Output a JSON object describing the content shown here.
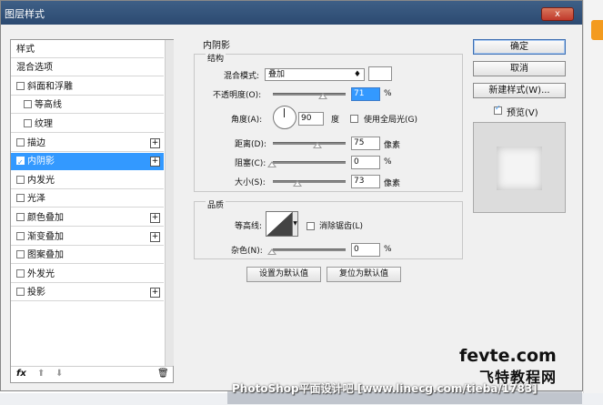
{
  "window": {
    "title": "图层样式",
    "close": "x"
  },
  "left_panel": {
    "items": [
      {
        "label": "样式"
      },
      {
        "label": "混合选项"
      },
      {
        "label": "斜面和浮雕"
      },
      {
        "label": "等高线"
      },
      {
        "label": "纹理"
      },
      {
        "label": "描边"
      },
      {
        "label": "内阴影"
      },
      {
        "label": "内发光"
      },
      {
        "label": "光泽"
      },
      {
        "label": "颜色叠加"
      },
      {
        "label": "渐变叠加"
      },
      {
        "label": "图案叠加"
      },
      {
        "label": "外发光"
      },
      {
        "label": "投影"
      }
    ],
    "footer": {
      "fx": "fx",
      "up": "⬆",
      "down": "⬇",
      "delete": "🗑"
    }
  },
  "inner_shadow": {
    "section_title": "内阴影",
    "structure_title": "结构",
    "blend_mode_label": "混合模式:",
    "blend_mode_value": "叠加",
    "opacity_label": "不透明度(O):",
    "opacity_value": "71",
    "percent": "%",
    "angle_label": "角度(A):",
    "angle_value": "90",
    "angle_unit": "度",
    "global_light_label": "使用全局光(G)",
    "distance_label": "距离(D):",
    "distance_value": "75",
    "px_unit": "像素",
    "choke_label": "阻塞(C):",
    "choke_value": "0",
    "size_label": "大小(S):",
    "size_value": "73",
    "quality_title": "品质",
    "contour_label": "等高线:",
    "antialias_label": "消除锯齿(L)",
    "noise_label": "杂色(N):",
    "noise_value": "0",
    "set_default": "设置为默认值",
    "reset_default": "复位为默认值"
  },
  "right_panel": {
    "ok": "确定",
    "cancel": "取消",
    "new_style": "新建样式(W)...",
    "preview_label": "预览(V)"
  },
  "watermark": {
    "text": "PhotoShop平面设计吧 [www.linecg.com/tieba/1783]",
    "logo_line1": "fevte.com",
    "logo_line2": "飞特教程网"
  }
}
